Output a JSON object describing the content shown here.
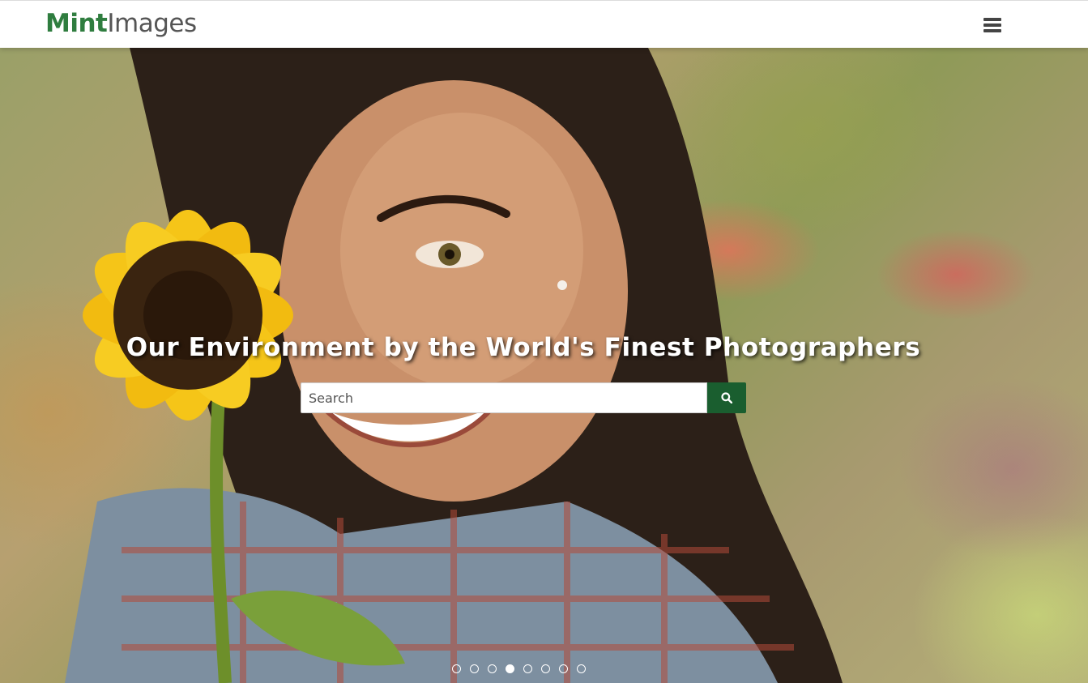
{
  "header": {
    "logo_part1": "Mint",
    "logo_part2": "Images",
    "menu_icon": "hamburger-menu-icon"
  },
  "hero": {
    "tagline": "Our Environment by the World's Finest Photographers",
    "search": {
      "placeholder": "Search",
      "value": "",
      "button_icon": "search-icon"
    },
    "carousel": {
      "slides": [
        "slide-1",
        "slide-2",
        "slide-3",
        "slide-4",
        "slide-5",
        "slide-6",
        "slide-7",
        "slide-8"
      ],
      "active_index": 3
    }
  },
  "colors": {
    "brand_green": "#2f7d3f",
    "button_green": "#1a5e2f",
    "logo_gray": "#555555"
  }
}
